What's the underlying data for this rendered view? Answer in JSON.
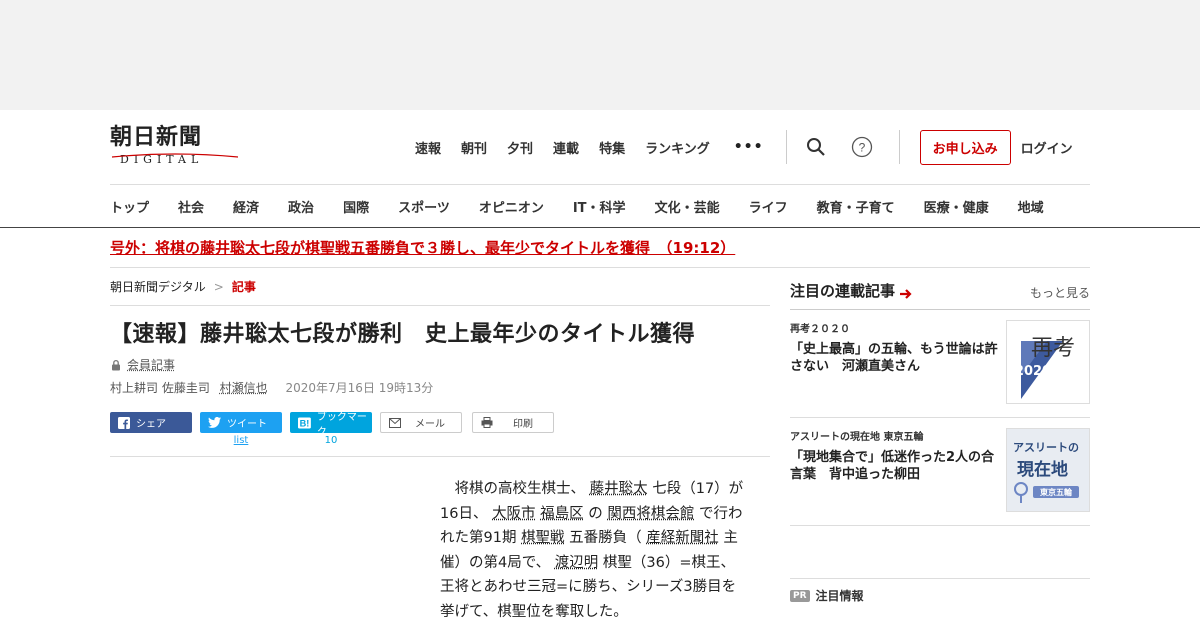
{
  "logo": {
    "kanji": "朝日新聞",
    "sub": "DIGITAL"
  },
  "topnav": [
    "速報",
    "朝刊",
    "夕刊",
    "連載",
    "特集",
    "ランキング"
  ],
  "more_dots": "•••",
  "header": {
    "apply": "お申し込み",
    "login": "ログイン"
  },
  "catnav": [
    "トップ",
    "社会",
    "経済",
    "政治",
    "国際",
    "スポーツ",
    "オピニオン",
    "IT・科学",
    "文化・芸能",
    "ライフ",
    "教育・子育て",
    "医療・健康",
    "地域"
  ],
  "breaking": "号外：将棋の藤井聡太七段が棋聖戦五番勝負で３勝し、最年少でタイトルを獲得　（19:12）",
  "breadcrumb": {
    "home": "朝日新聞デジタル",
    "sep": ">",
    "current": "記事"
  },
  "article": {
    "title": "【速報】藤井聡太七段が勝利　史上最年少のタイトル獲得",
    "member": "会員記事",
    "authors": "村上耕司 佐藤圭司",
    "author3": "村瀬信也",
    "date": "2020年7月16日 19時13分",
    "body": [
      {
        "t": "　将棋の高校生棋士、 "
      },
      {
        "t": "藤井聡太",
        "u": true
      },
      {
        "t": " 七段（17）が16日、 "
      },
      {
        "t": "大阪市",
        "u": true
      },
      {
        "t": " "
      },
      {
        "t": "福島区",
        "u": true
      },
      {
        "t": " の "
      },
      {
        "t": "関西将棋会館",
        "u": true
      },
      {
        "t": " で行われた第91期 "
      },
      {
        "t": "棋聖戦",
        "u": true
      },
      {
        "t": " 五番勝負（ "
      },
      {
        "t": "産経新聞社",
        "u": true
      },
      {
        "t": " 主催）の第4局で、 "
      },
      {
        "t": "渡辺明",
        "u": true
      },
      {
        "t": " 棋聖（36）=棋王、王将とあわせ三冠=に勝ち、シリーズ3勝目を挙げて、棋聖位を奪取した。"
      }
    ]
  },
  "share": {
    "facebook": "シェア",
    "twitter": "ツイート",
    "hatena": "ブックマーク",
    "mail": "メール",
    "print": "印刷",
    "twitter_count": "list",
    "hatena_count": "10"
  },
  "sidebar": {
    "title": "注目の連載記事",
    "more": "もっと見る",
    "cards": [
      {
        "kicker": "再考２０２０",
        "headline": "「史上最高」の五輪、もう世論は許さない　河瀬直美さん",
        "thumb_text1": "再考",
        "thumb_text2": "2020"
      },
      {
        "kicker": "アスリートの現在地 東京五輪",
        "headline": "「現地集合で」低迷作った2人の合言葉　背中追った柳田",
        "thumb_text1": "アスリートの",
        "thumb_text2": "現在地",
        "thumb_text3": "東京五輪"
      }
    ],
    "pr_badge": "PR",
    "pr_label": "注目情報"
  },
  "colors": {
    "accent": "#cc0000",
    "facebook": "#3b5998",
    "twitter": "#1da1f2",
    "hatena": "#00a4de"
  }
}
